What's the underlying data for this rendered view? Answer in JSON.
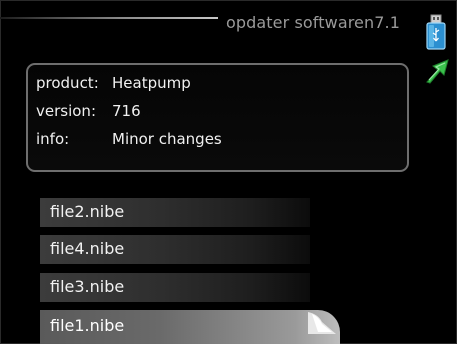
{
  "header": {
    "title": "opdater softwaren7.1",
    "usb_icon": "usb-stick-icon",
    "back_icon": "back-arrow-icon",
    "accent": "#39a8e0",
    "back_color": "#38c24a"
  },
  "info_box": {
    "product_key": "product:",
    "product_value": "Heatpump",
    "version_key": "version:",
    "version_value": "716",
    "info_key": "info:",
    "info_value": "Minor changes"
  },
  "files": [
    {
      "label": "file2.nibe",
      "selected": false
    },
    {
      "label": "file4.nibe",
      "selected": false
    },
    {
      "label": "file3.nibe",
      "selected": false
    },
    {
      "label": "file1.nibe",
      "selected": true
    }
  ]
}
